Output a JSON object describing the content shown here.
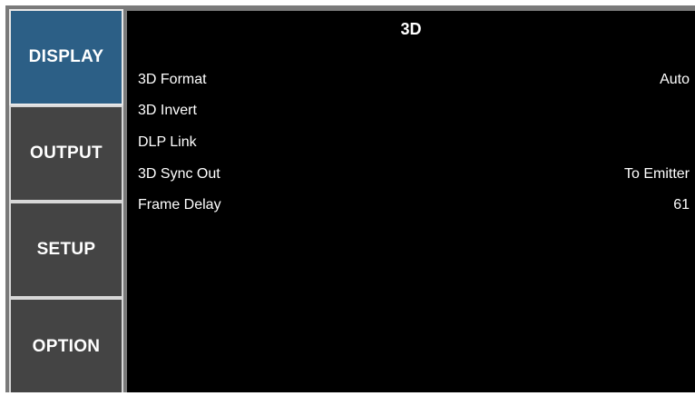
{
  "sidebar": {
    "tabs": [
      {
        "label": "DISPLAY",
        "active": true
      },
      {
        "label": "OUTPUT",
        "active": false
      },
      {
        "label": "SETUP",
        "active": false
      },
      {
        "label": "OPTION",
        "active": false
      }
    ]
  },
  "main": {
    "title": "3D",
    "rows": [
      {
        "label": "3D Format",
        "value": "Auto"
      },
      {
        "label": "3D Invert",
        "value": ""
      },
      {
        "label": "DLP Link",
        "value": ""
      },
      {
        "label": "3D Sync Out",
        "value": "To Emitter"
      },
      {
        "label": "Frame Delay",
        "value": "61"
      }
    ]
  },
  "colors": {
    "active_tab": "#2c5f86",
    "inactive_tab": "#444444",
    "panel_bg": "#000000",
    "frame": "#7a7a7a"
  }
}
